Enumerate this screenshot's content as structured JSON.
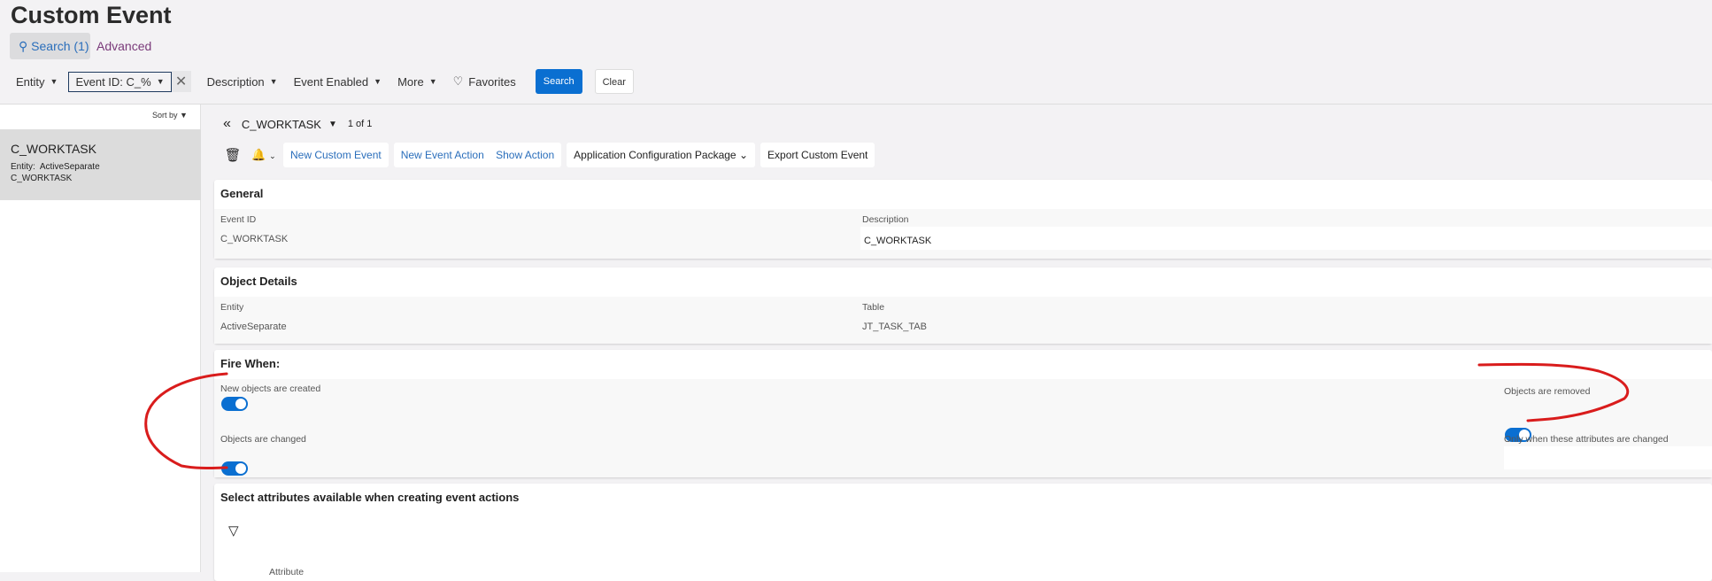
{
  "page": {
    "title": "Custom Event"
  },
  "search_tabs": {
    "search": "Search (1)",
    "advanced": "Advanced"
  },
  "filters": {
    "entity": "Entity",
    "event_id": "Event ID: C_%",
    "description": "Description",
    "event_enabled": "Event Enabled",
    "more": "More",
    "favorites": "Favorites",
    "search_button": "Search",
    "clear_button": "Clear"
  },
  "list": {
    "sort_by": "Sort by",
    "items": [
      {
        "name": "C_WORKTASK",
        "entity_label": "Entity:",
        "entity_value": "ActiveSeparate",
        "sub": "C_WORKTASK"
      }
    ]
  },
  "record_nav": {
    "title": "C_WORKTASK",
    "count": "1 of 1"
  },
  "toolbar": {
    "new_custom_event": "New Custom Event",
    "new_event_action": "New Event Action",
    "show_action": "Show Action",
    "app_config_package": "Application Configuration Package",
    "export_custom_event": "Export Custom Event"
  },
  "general": {
    "title": "General",
    "event_id_label": "Event ID",
    "event_id_value": "C_WORKTASK",
    "description_label": "Description",
    "description_value": "C_WORKTASK"
  },
  "object_details": {
    "title": "Object Details",
    "entity_label": "Entity",
    "entity_value": "ActiveSeparate",
    "table_label": "Table",
    "table_value": "JT_TASK_TAB"
  },
  "fire_when": {
    "title": "Fire When:",
    "new_objects_created": {
      "label": "New objects are created",
      "on": true
    },
    "objects_changed": {
      "label": "Objects are changed",
      "on": true
    },
    "objects_removed": {
      "label": "Objects are removed",
      "on": true
    },
    "only_when_label": "Only when these attributes are changed",
    "only_when_value": ""
  },
  "attributes": {
    "title": "Select attributes available when creating event actions",
    "column": "Attribute"
  },
  "colors": {
    "accent": "#0a6fd1",
    "annotation": "#d91c1c"
  }
}
